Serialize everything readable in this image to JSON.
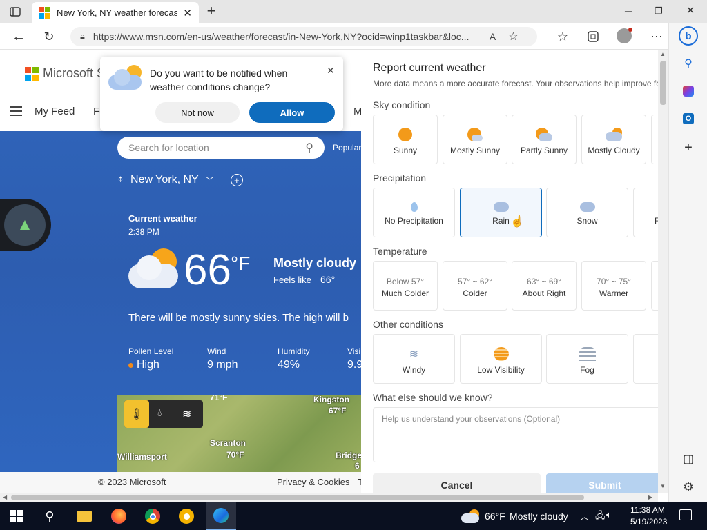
{
  "browser": {
    "tab_title": "New York, NY weather forecast | M",
    "url": "https://www.msn.com/en-us/weather/forecast/in-New-York,NY?ocid=winp1taskbar&loc..."
  },
  "site": {
    "brand": "Microsoft St",
    "nav": {
      "feed": "My Feed",
      "fo": "Fo",
      "m": "M"
    },
    "search_placeholder": "Search for location",
    "popular": "Popular",
    "location": "New York, NY",
    "current": {
      "heading": "Current weather",
      "time": "2:38 PM",
      "temp": "66",
      "unit": "°F",
      "condition": "Mostly cloudy",
      "feels_label": "Feels like",
      "feels_value": "66°",
      "summary": "There will be mostly sunny skies. The high will b"
    },
    "stats": [
      {
        "label": "Pollen Level",
        "value": "High"
      },
      {
        "label": "Wind",
        "value": "9 mph"
      },
      {
        "label": "Humidity",
        "value": "49%"
      },
      {
        "label": "Visi",
        "value": "9.9"
      }
    ],
    "map_labels": {
      "kingston": "Kingston",
      "kingston_temp": "67°F",
      "top_temp": "71°F",
      "scranton": "Scranton",
      "scranton_temp": "70°F",
      "williamsport": "Williamsport",
      "bridge": "Bridge",
      "bridge_temp": "6"
    },
    "footer": {
      "copyright": "© 2023 Microsoft",
      "privacy": "Privacy & Cookies",
      "t": "T"
    }
  },
  "notify_popup": {
    "question": "Do you want to be notified when weather conditions change?",
    "not_now": "Not now",
    "allow": "Allow"
  },
  "report": {
    "title": "Report current weather",
    "subtitle": "More data means a more accurate forecast. Your observations help improve fo",
    "sky_heading": "Sky condition",
    "sky": [
      "Sunny",
      "Mostly Sunny",
      "Partly Sunny",
      "Mostly Cloudy"
    ],
    "precip_heading": "Precipitation",
    "precip": [
      "No Precipitation",
      "Rain",
      "Snow",
      "F"
    ],
    "temp_heading": "Temperature",
    "temps": [
      {
        "range": "Below 57°",
        "label": "Much Colder"
      },
      {
        "range": "57° ~ 62°",
        "label": "Colder"
      },
      {
        "range": "63° ~ 69°",
        "label": "About Right"
      },
      {
        "range": "70° ~ 75°",
        "label": "Warmer"
      }
    ],
    "other_heading": "Other conditions",
    "other": [
      "Windy",
      "Low Visibility",
      "Fog"
    ],
    "question": "What else should we know?",
    "placeholder": "Help us understand your observations (Optional)",
    "cancel": "Cancel",
    "submit": "Submit"
  },
  "taskbar": {
    "weather_temp": "66°F",
    "weather_cond": "Mostly cloudy",
    "time": "11:38 AM",
    "date": "5/19/2023"
  },
  "colors": {
    "accent": "#0f6cbd",
    "hero": "#2f63b8",
    "taskbar": "#0a1020"
  }
}
